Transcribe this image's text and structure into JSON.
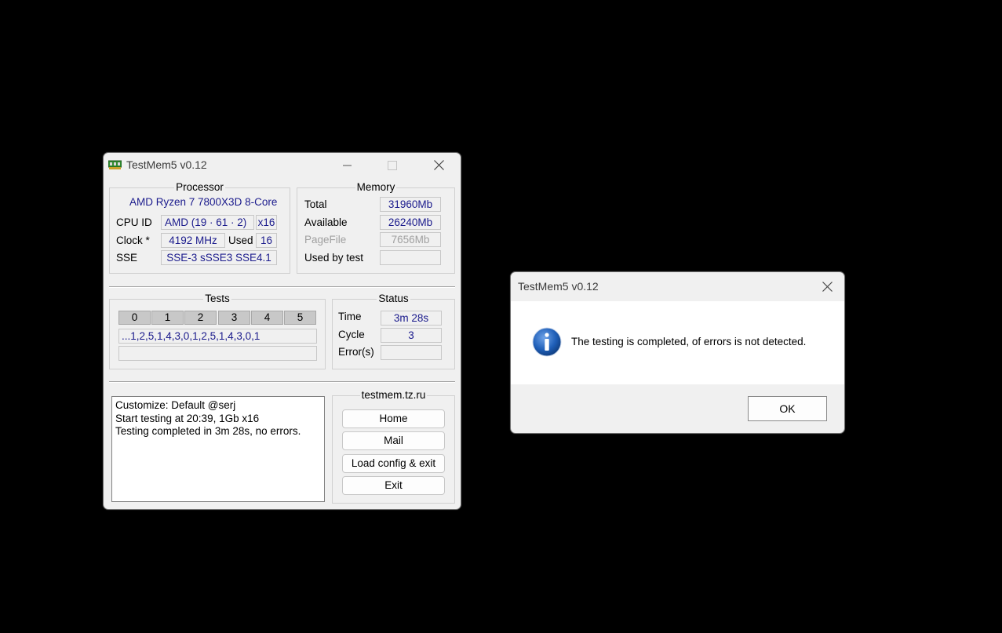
{
  "main": {
    "title": "TestMem5 v0.12",
    "processor": {
      "label": "Processor",
      "name": "AMD Ryzen 7 7800X3D 8-Core",
      "cpu_id_label": "CPU ID",
      "cpu_id": "AMD  (19 · 61 · 2)",
      "threads": "x16",
      "clock_label": "Clock *",
      "clock": "4192 MHz",
      "used_label": "Used",
      "used": "16",
      "sse_label": "SSE",
      "sse": "SSE-3 sSSE3 SSE4.1"
    },
    "memory": {
      "label": "Memory",
      "total_label": "Total",
      "total": "31960Mb",
      "available_label": "Available",
      "available": "26240Mb",
      "pagefile_label": "PageFile",
      "pagefile": "7656Mb",
      "used_by_test_label": "Used by test",
      "used_by_test": ""
    },
    "tests": {
      "label": "Tests",
      "columns": [
        "0",
        "1",
        "2",
        "3",
        "4",
        "5"
      ],
      "sequence": "...1,2,5,1,4,3,0,1,2,5,1,4,3,0,1",
      "progress": ""
    },
    "status": {
      "label": "Status",
      "time_label": "Time",
      "time": "3m 28s",
      "cycle_label": "Cycle",
      "cycle": "3",
      "errors_label": "Error(s)",
      "errors": ""
    },
    "log": {
      "lines": [
        "Customize: Default @serj",
        "Start testing at 20:39, 1Gb x16",
        "Testing completed in 3m 28s, no errors."
      ]
    },
    "links": {
      "label": "testmem.tz.ru",
      "home": "Home",
      "mail": "Mail",
      "load_config": "Load config & exit",
      "exit": "Exit"
    }
  },
  "dialog": {
    "title": "TestMem5 v0.12",
    "icon": "info-icon",
    "message": "The testing is completed, of errors is not detected.",
    "ok": "OK"
  },
  "colors": {
    "background": "#000000",
    "window": "#f0f0f0",
    "value_text": "#1a1a8c",
    "info_icon": "#1f5fb8"
  }
}
